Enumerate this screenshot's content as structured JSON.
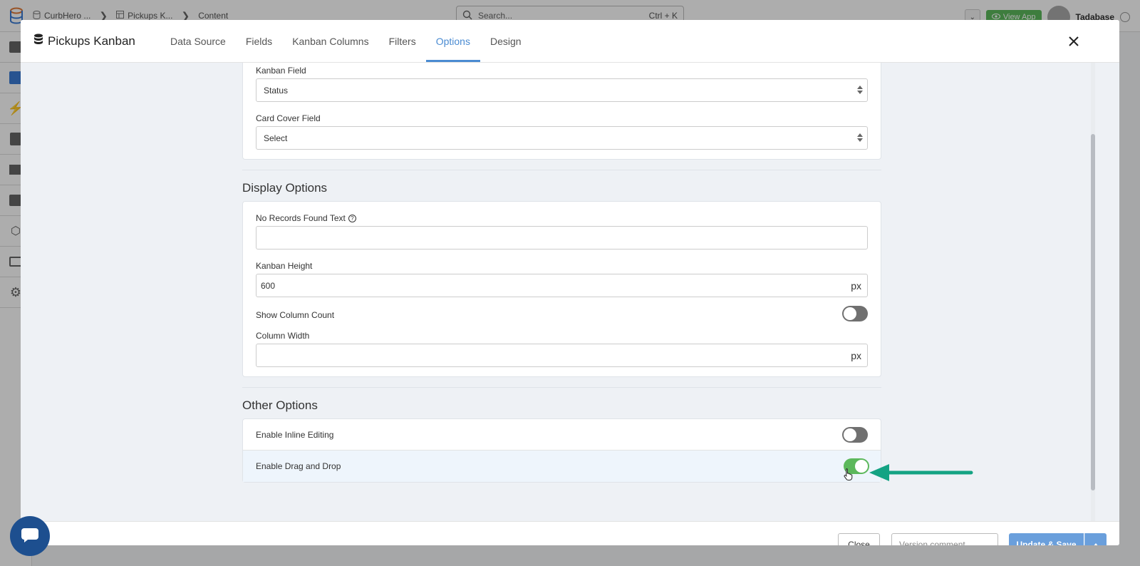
{
  "app": {
    "breadcrumbs": [
      "CurbHero ...",
      "Pickups K...",
      "Content"
    ],
    "search_placeholder": "Search...",
    "search_shortcut": "Ctrl + K",
    "view_app_label": "View App",
    "user_name": "Tadabase"
  },
  "modal": {
    "title": "Pickups Kanban",
    "tabs": [
      {
        "label": "Data Source"
      },
      {
        "label": "Fields"
      },
      {
        "label": "Kanban Columns"
      },
      {
        "label": "Filters"
      },
      {
        "label": "Options",
        "active": true
      },
      {
        "label": "Design"
      }
    ]
  },
  "fields": {
    "kanban_field_label": "Kanban Field",
    "kanban_field_value": "Status",
    "card_cover_label": "Card Cover Field",
    "card_cover_value": "Select"
  },
  "display": {
    "title": "Display Options",
    "no_records_label": "No Records Found Text",
    "no_records_value": "",
    "height_label": "Kanban Height",
    "height_value": "600",
    "px_unit": "px",
    "show_count_label": "Show Column Count",
    "show_count_on": false,
    "column_width_label": "Column Width",
    "column_width_value": ""
  },
  "other": {
    "title": "Other Options",
    "inline_label": "Enable Inline Editing",
    "inline_on": false,
    "dnd_label": "Enable Drag and Drop",
    "dnd_on": true
  },
  "footer": {
    "close_label": "Close",
    "version_placeholder": "Version comment",
    "save_label": "Update & Save"
  },
  "colors": {
    "accent": "#4a8bd2",
    "toggle_on": "#5cb85c",
    "annotation_arrow": "#14a383"
  }
}
